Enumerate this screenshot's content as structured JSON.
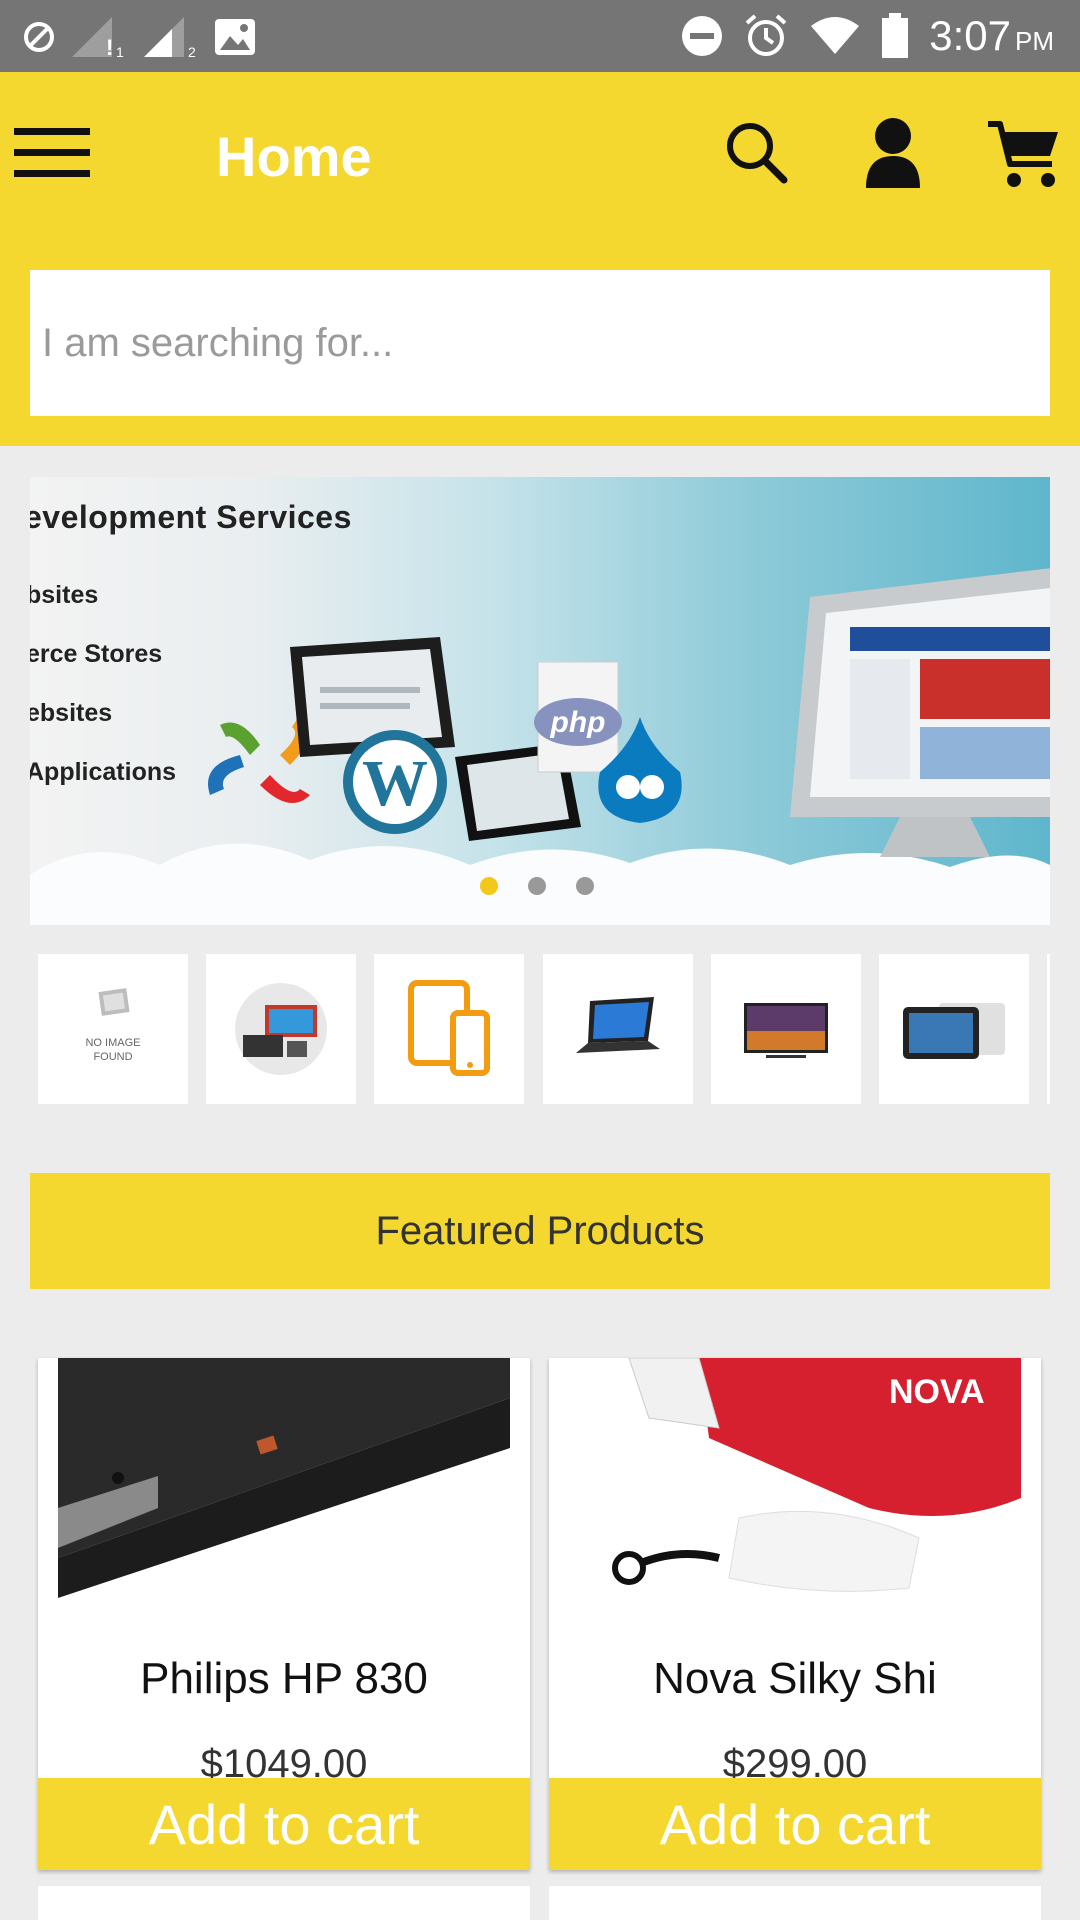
{
  "status_bar": {
    "time": "3:07",
    "ampm": "PM",
    "icons": [
      "no-disturb-icon",
      "signal-1-icon",
      "signal-2-icon",
      "image-icon",
      "dnd-icon",
      "alarm-icon",
      "wifi-icon",
      "battery-icon"
    ]
  },
  "toolbar": {
    "title": "Home",
    "icons": [
      "menu-icon",
      "search-icon",
      "user-icon",
      "cart-icon"
    ]
  },
  "search": {
    "placeholder": "I am searching for..."
  },
  "banner": {
    "heading": "evelopment Services",
    "lines": [
      "bsites",
      "erce Stores",
      "ebsites",
      "Applications"
    ],
    "logos": [
      "joomla-icon",
      "wordpress-icon",
      "php-icon",
      "drupal-icon"
    ],
    "php_label": "php",
    "slides": 3,
    "active_slide": 1
  },
  "categories": [
    {
      "name": "no-image",
      "label_1": "NO IMAGE",
      "label_2": "FOUND"
    },
    {
      "name": "home-appliances"
    },
    {
      "name": "mobiles-tablets"
    },
    {
      "name": "laptops"
    },
    {
      "name": "televisions"
    },
    {
      "name": "tablets"
    }
  ],
  "featured": {
    "title": "Featured Products"
  },
  "products": [
    {
      "name": "Philips HP 830",
      "price": "$1049.00",
      "button": "Add to cart"
    },
    {
      "name": "Nova Silky Shi",
      "price": "$299.00",
      "button": "Add to cart",
      "brand": "NOVA"
    }
  ],
  "colors": {
    "accent": "#f4d830",
    "status_bar": "#757575",
    "background": "#ececec"
  }
}
